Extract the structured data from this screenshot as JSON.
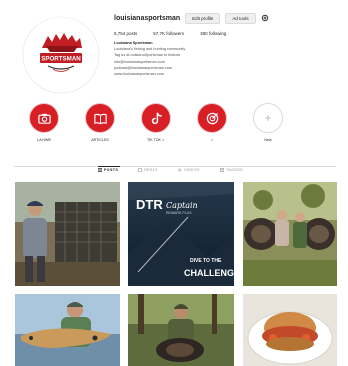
{
  "profile": {
    "username": "louisianasportsman",
    "edit_label": "Edit profile",
    "archive_label": "Ad tools",
    "logo_text": "SPORTSMAN",
    "stats": {
      "posts": "5,754 posts",
      "followers": "57.7K followers",
      "following": "380 following"
    },
    "bio": {
      "name": "Louisiana Sportsman",
      "line1": "Louisiana's fishing and hunting community",
      "line2": "Tag us #LouisianaSportsman to feature",
      "line3": "info@louisianasportsman.com",
      "line4": "podcast@louisianasportsman.com",
      "link": "www.louisianasportsman.com"
    }
  },
  "highlights": [
    {
      "label": "LA HWB",
      "icon": "camera-icon"
    },
    {
      "label": "ARTICLES",
      "icon": "book-icon"
    },
    {
      "label": "TIK TOK ✓",
      "icon": "tiktok-icon"
    },
    {
      "label": "✓",
      "icon": "target-icon"
    },
    {
      "label": "New",
      "icon": "plus-icon"
    }
  ],
  "tabs": [
    {
      "label": "POSTS",
      "active": true
    },
    {
      "label": "REELS",
      "active": false
    },
    {
      "label": "VIDEOS",
      "active": false
    },
    {
      "label": "TAGGED",
      "active": false
    }
  ],
  "posts": [
    {
      "type": "photo",
      "subject": "man-with-crawfish-trap"
    },
    {
      "type": "promo",
      "brand": "DTR",
      "brand_script": "Captain",
      "sub": "REWARD PLUS",
      "line1": "DIVE TO THE",
      "line2": "CHALLENGE"
    },
    {
      "type": "photo",
      "subject": "turkey-hunters-group"
    },
    {
      "type": "photo",
      "subject": "man-holding-redfish"
    },
    {
      "type": "photo",
      "subject": "hunter-with-turkey"
    },
    {
      "type": "photo",
      "subject": "crawfish-sandwich"
    }
  ],
  "colors": {
    "accent": "#d91f26",
    "text": "#262626",
    "muted": "#8e8e8e",
    "border": "#dbdbdb"
  }
}
